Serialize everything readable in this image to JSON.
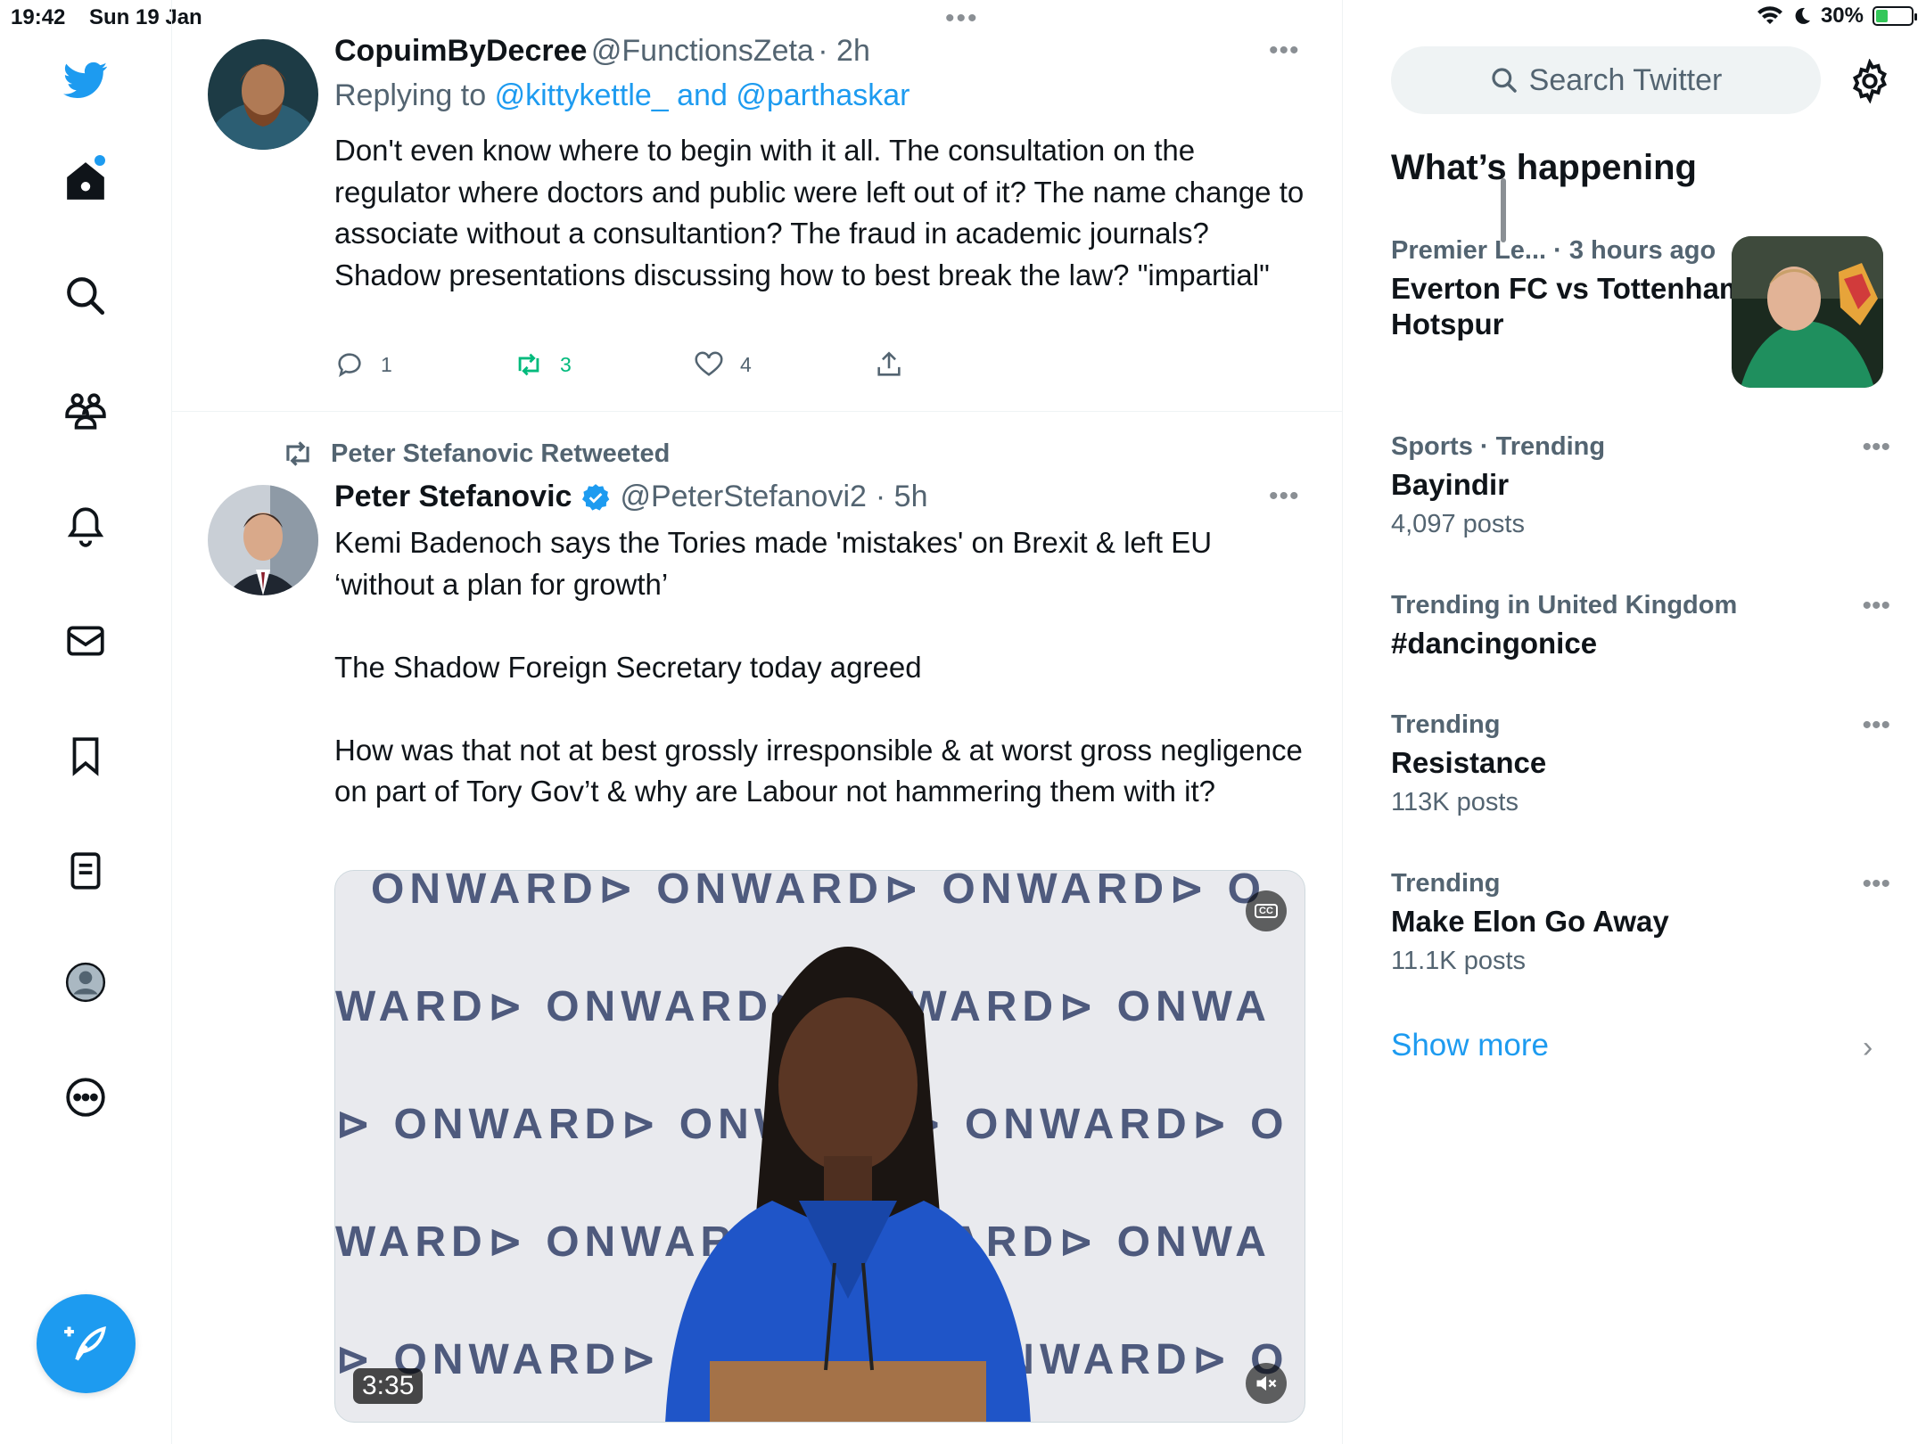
{
  "status_bar": {
    "time": "19:42",
    "date": "Sun 19 Jan",
    "battery": "30%",
    "battery_level": 0.3
  },
  "nav": {
    "items": [
      "twitter-logo",
      "home",
      "explore",
      "communities",
      "notifications",
      "messages",
      "bookmarks",
      "lists",
      "profile",
      "more"
    ]
  },
  "tweets": [
    {
      "name": "CopuimByDecree",
      "handle": "@FunctionsZeta",
      "time": "· 2h",
      "replying_prefix": "Replying to",
      "replying_to": "@kittykettle_ and @parthaskar",
      "text": "Don't even know where to begin with it all. The consultation on the regulator where doctors and public were left out of it? The name change to associate without a consultantion? The fraud in academic journals? Shadow presentations discussing how to best break the law? \"impartial\"",
      "replies": "1",
      "retweets": "3",
      "likes": "4"
    },
    {
      "retweeted_by": "Peter Stefanovic Retweeted",
      "name": "Peter Stefanovic",
      "handle": "@PeterStefanovi2",
      "time": "· 5h",
      "para1": "Kemi Badenoch says the Tories made 'mistakes' on Brexit & left EU ‘without a plan for growth’",
      "para2": "The Shadow Foreign Secretary today agreed",
      "para3": "How was that not at best grossly irresponsible & at worst gross negligence on part of Tory Gov’t & why are Labour not hammering them with it?",
      "media": {
        "duration": "3:35",
        "backdrop_rows": [
          "ONWARD⊳  ONWARD⊳  ONWARD⊳ O",
          "WARD⊳ ONWARD⊳ ONWARD⊳ ONWA",
          "⊳ ONWARD⊳ ONWARD⊳ ONWARD⊳ O",
          "WARD⊳ ONWARD⊳ ONWARD⊳ ONWA",
          "⊳ ONWARD⊳ ONWARD⊳ ONWARD⊳ O"
        ]
      }
    }
  ],
  "sidebar": {
    "search_placeholder": "Search Twitter",
    "happening_title": "What’s happening",
    "trends": [
      {
        "context": "Premier Le... · 3 hours ago",
        "title": "Everton FC vs Tottenham Hotspur",
        "count": ""
      },
      {
        "context": "Sports · Trending",
        "title": "Bayindir",
        "count": "4,097 posts"
      },
      {
        "context": "Trending in United Kingdom",
        "title": "#dancingonice",
        "count": ""
      },
      {
        "context": "Trending",
        "title": "Resistance",
        "count": "113K posts"
      },
      {
        "context": "Trending",
        "title": "Make Elon Go Away",
        "count": "11.1K posts"
      }
    ],
    "show_more": "Show more"
  },
  "colors": {
    "accent": "#1d9bf0",
    "retweet_green": "#00ba7c",
    "muted": "#536471"
  }
}
